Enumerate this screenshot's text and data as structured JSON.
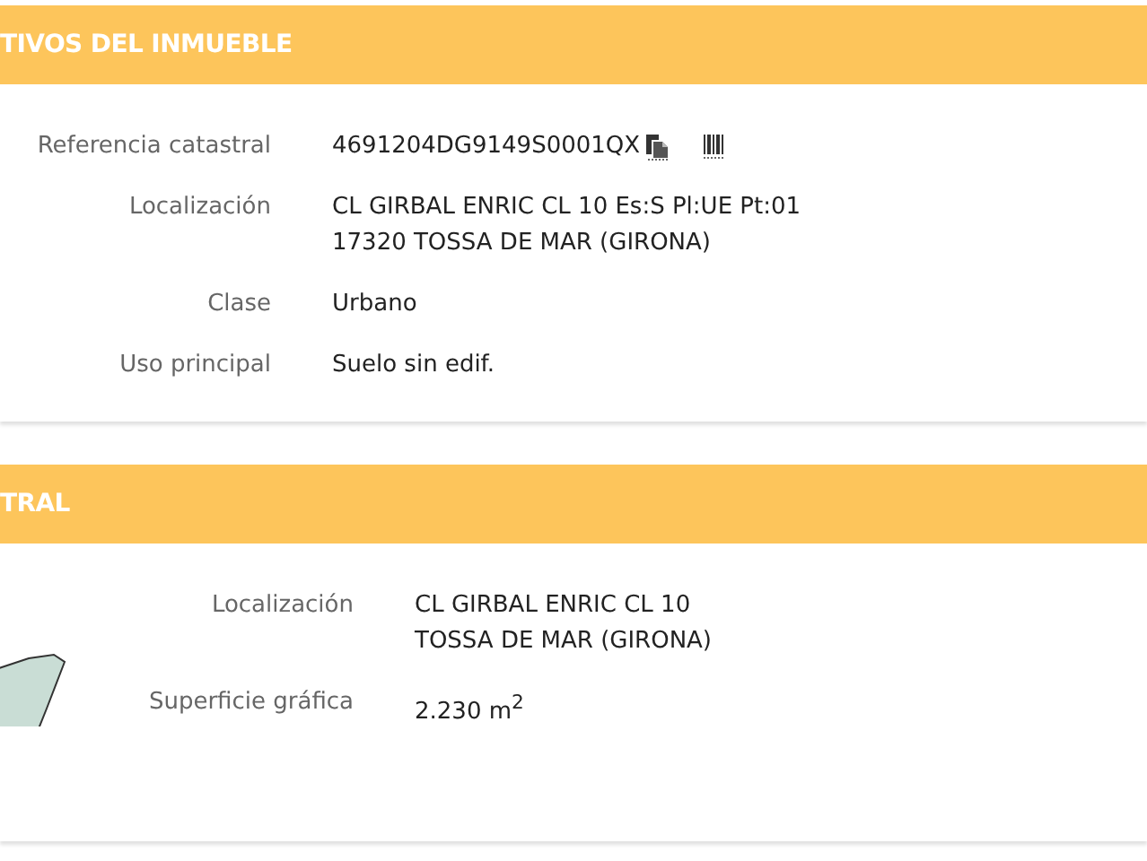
{
  "sections": [
    {
      "title": "TIVOS DEL INMUEBLE",
      "kind": "property",
      "rows": [
        {
          "label": "Referencia catastral",
          "lines": [
            "4691204DG9149S0001QX"
          ],
          "actions": [
            {
              "kind": "copy"
            },
            {
              "kind": "barcode"
            }
          ]
        },
        {
          "label": "Localización",
          "lines": [
            "CL GIRBAL ENRIC CL 10 Es:S Pl:UE Pt:01",
            "17320 TOSSA DE MAR (GIRONA)"
          ]
        },
        {
          "label": "Clase",
          "lines": [
            "Urbano"
          ]
        },
        {
          "label": "Uso principal",
          "lines": [
            "Suelo sin edif."
          ]
        }
      ]
    },
    {
      "title": "TRAL",
      "kind": "parcel",
      "rows": [
        {
          "label": "Localización",
          "lines": [
            "CL GIRBAL ENRIC CL 10",
            "TOSSA DE MAR (GIRONA)"
          ]
        },
        {
          "label": "Superficie gráfica",
          "lines": [
            "2.230 m$^{2}$"
          ]
        }
      ]
    }
  ]
}
